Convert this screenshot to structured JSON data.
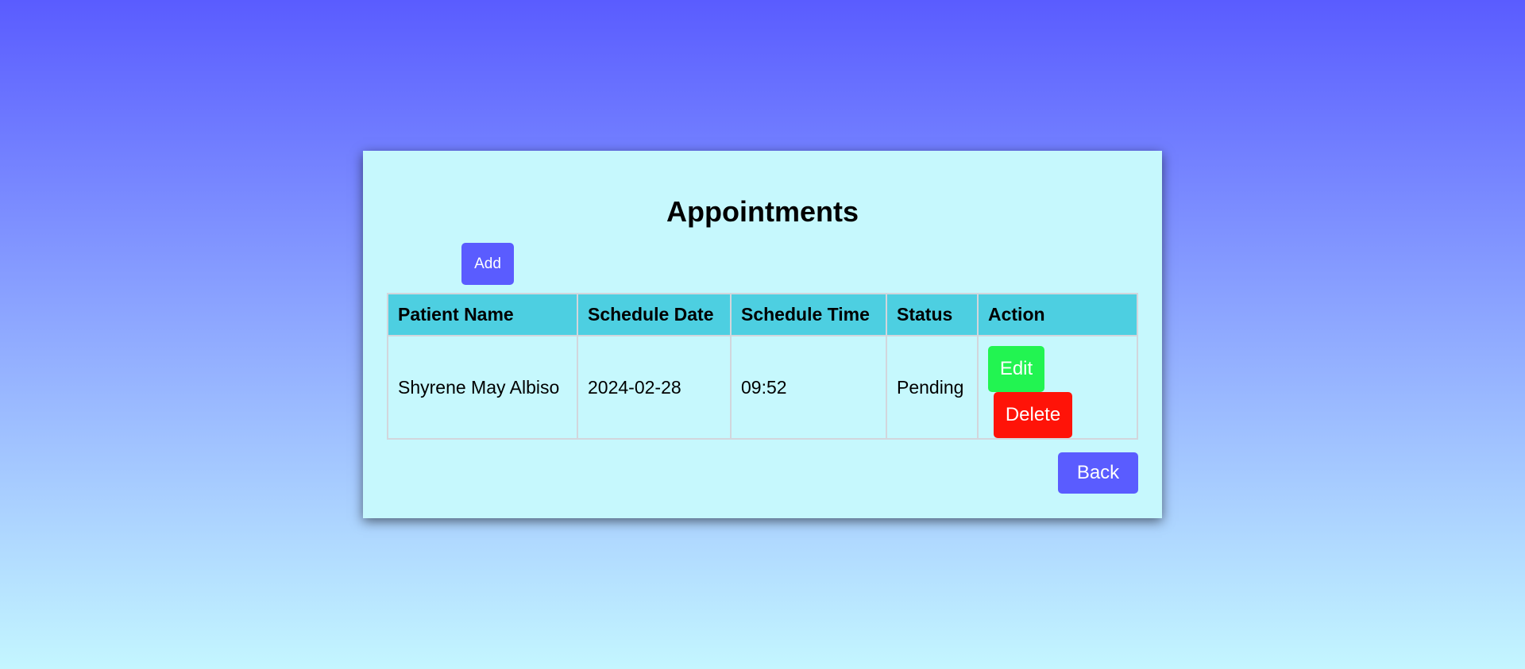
{
  "page": {
    "title": "Appointments"
  },
  "toolbar": {
    "add_label": "Add",
    "back_label": "Back"
  },
  "table": {
    "headers": [
      "Patient Name",
      "Schedule Date",
      "Schedule Time",
      "Status",
      "Action"
    ],
    "rows": [
      {
        "patient_name": "Shyrene May Albiso",
        "schedule_date": "2024-02-28",
        "schedule_time": "09:52",
        "status": "Pending",
        "edit_label": "Edit",
        "delete_label": "Delete"
      }
    ]
  },
  "colors": {
    "primary": "#5a5cff",
    "header_bg": "#4dcfe1",
    "card_bg": "#c6f8fd",
    "edit": "#22f451",
    "delete": "#ff1308"
  }
}
